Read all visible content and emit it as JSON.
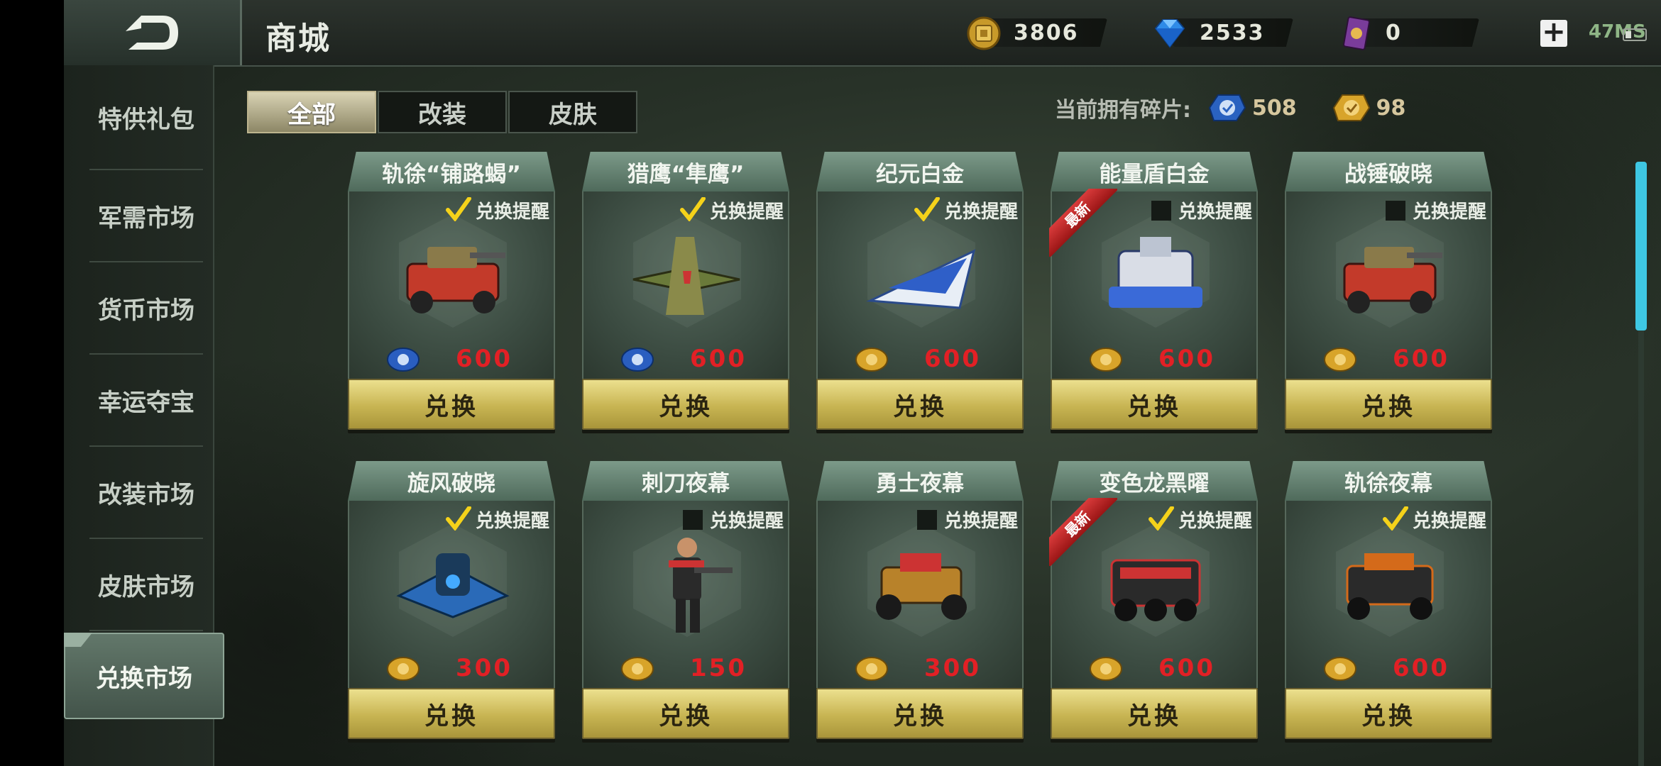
{
  "header": {
    "title": "商城",
    "back_icon": "back-arrow-icon",
    "currencies": [
      {
        "name": "gold-coin",
        "value": "3806",
        "icon": "gold-coin-icon"
      },
      {
        "name": "diamond",
        "value": "2533",
        "icon": "diamond-icon"
      },
      {
        "name": "card",
        "value": "0",
        "icon": "card-icon"
      }
    ],
    "plus_label": "+",
    "network": "47MS"
  },
  "sidebar": {
    "items": [
      {
        "label": "特供礼包",
        "active": false
      },
      {
        "label": "军需市场",
        "active": false
      },
      {
        "label": "货币市场",
        "active": false
      },
      {
        "label": "幸运夺宝",
        "active": false
      },
      {
        "label": "改装市场",
        "active": false
      },
      {
        "label": "皮肤市场",
        "active": false
      },
      {
        "label": "兑换市场",
        "active": true
      }
    ]
  },
  "tabs": [
    {
      "label": "全部",
      "active": true
    },
    {
      "label": "改装",
      "active": false
    },
    {
      "label": "皮肤",
      "active": false
    }
  ],
  "fragments": {
    "label": "当前拥有碎片:",
    "blue": "508",
    "gold": "98"
  },
  "cards": [
    {
      "title": "轨徐“铺路蝎”",
      "remind_label": "兑换提醒",
      "reminder": true,
      "new": false,
      "currency": "blue",
      "price": "600",
      "button": "兑换",
      "item_icon": "tank-icon"
    },
    {
      "title": "猎鹰“隼鹰”",
      "remind_label": "兑换提醒",
      "reminder": true,
      "new": false,
      "currency": "blue",
      "price": "600",
      "button": "兑换",
      "item_icon": "fighter-jet-icon"
    },
    {
      "title": "纪元白金",
      "remind_label": "兑换提醒",
      "reminder": true,
      "new": false,
      "currency": "gold",
      "price": "600",
      "button": "兑换",
      "item_icon": "jet-icon"
    },
    {
      "title": "能量盾白金",
      "remind_label": "兑换提醒",
      "reminder": false,
      "new": true,
      "new_label": "最新",
      "currency": "gold",
      "price": "600",
      "button": "兑换",
      "item_icon": "mech-icon"
    },
    {
      "title": "战锤破晓",
      "remind_label": "兑换提醒",
      "reminder": false,
      "new": false,
      "currency": "gold",
      "price": "600",
      "button": "兑换",
      "item_icon": "tank-icon"
    },
    {
      "title": "旋风破晓",
      "remind_label": "兑换提醒",
      "reminder": true,
      "new": false,
      "currency": "gold",
      "price": "300",
      "button": "兑换",
      "item_icon": "aircraft-icon"
    },
    {
      "title": "刺刀夜幕",
      "remind_label": "兑换提醒",
      "reminder": false,
      "new": false,
      "currency": "gold",
      "price": "150",
      "button": "兑换",
      "item_icon": "soldier-icon"
    },
    {
      "title": "勇士夜幕",
      "remind_label": "兑换提醒",
      "reminder": false,
      "new": false,
      "currency": "gold",
      "price": "300",
      "button": "兑换",
      "item_icon": "buggy-icon"
    },
    {
      "title": "变色龙黑曜",
      "remind_label": "兑换提醒",
      "reminder": true,
      "new": true,
      "new_label": "最新",
      "currency": "gold",
      "price": "600",
      "button": "兑换",
      "item_icon": "armored-truck-icon"
    },
    {
      "title": "轨徐夜幕",
      "remind_label": "兑换提醒",
      "reminder": true,
      "new": false,
      "currency": "gold",
      "price": "600",
      "button": "兑换",
      "item_icon": "truck-icon"
    }
  ],
  "colors": {
    "price": "#e22025",
    "accent": "#3ec7e3",
    "button": "#c7b452"
  }
}
